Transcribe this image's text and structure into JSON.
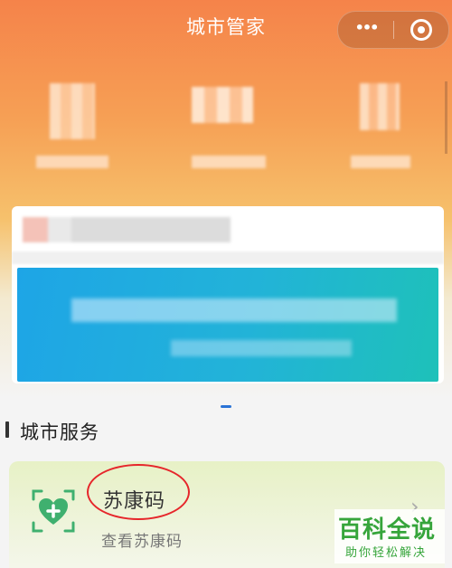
{
  "header": {
    "title": "城市管家"
  },
  "capsule": {
    "more_icon": "more-dots-icon",
    "close_icon": "target-circle-icon"
  },
  "section": {
    "title": "城市服务"
  },
  "service": {
    "name": "苏康码",
    "subtitle": "查看苏康码",
    "icon": "heart-plus-scan-icon",
    "chevron": "›"
  },
  "watermark": {
    "title": "百科全说",
    "subtitle": "助你轻松解决"
  },
  "colors": {
    "accent": "#f5834a",
    "banner": "#1ea5e6",
    "icon_green": "#3fb06f",
    "annotation": "#e6262b"
  }
}
